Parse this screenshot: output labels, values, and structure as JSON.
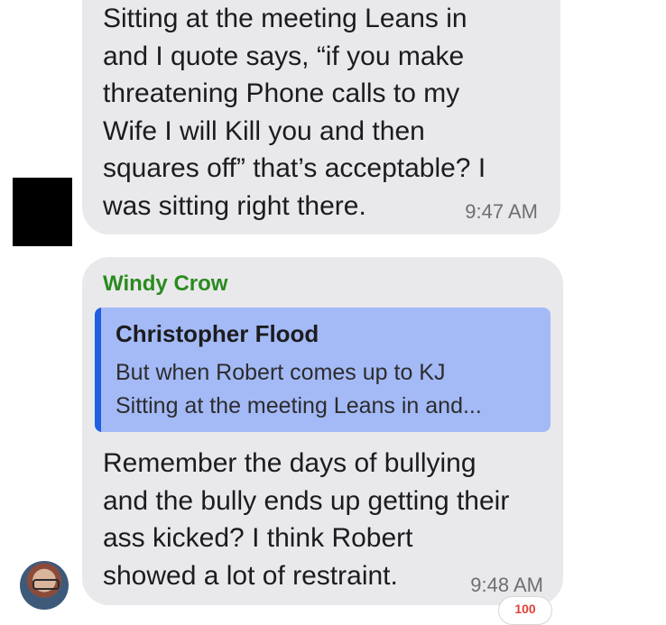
{
  "messages": [
    {
      "text": "Sitting at the meeting Leans in\nand I quote says, “if you make\nthreatening Phone calls to my\nWife I will Kill you and then\nsquares off” that’s acceptable? I\nwas sitting right there.",
      "time": "9:47 AM"
    },
    {
      "sender": "Windy Crow",
      "quote": {
        "author": "Christopher Flood",
        "text": "But when Robert comes up to KJ\nSitting at the meeting Leans in and..."
      },
      "text": "Remember the days of bullying\nand the bully ends up getting their\nass kicked?  I think Robert\nshowed a lot of restraint.",
      "time": "9:48 AM",
      "reaction": "100"
    }
  ],
  "colors": {
    "bubble": "#e9e9eb",
    "sender_name": "#2a8a1f",
    "quote_background": "#a4baf6",
    "quote_bar": "#1f5fe0",
    "redaction": "#000000"
  },
  "icons": {
    "avatar": "user-avatar",
    "reaction": "hundred-points-emoji"
  }
}
